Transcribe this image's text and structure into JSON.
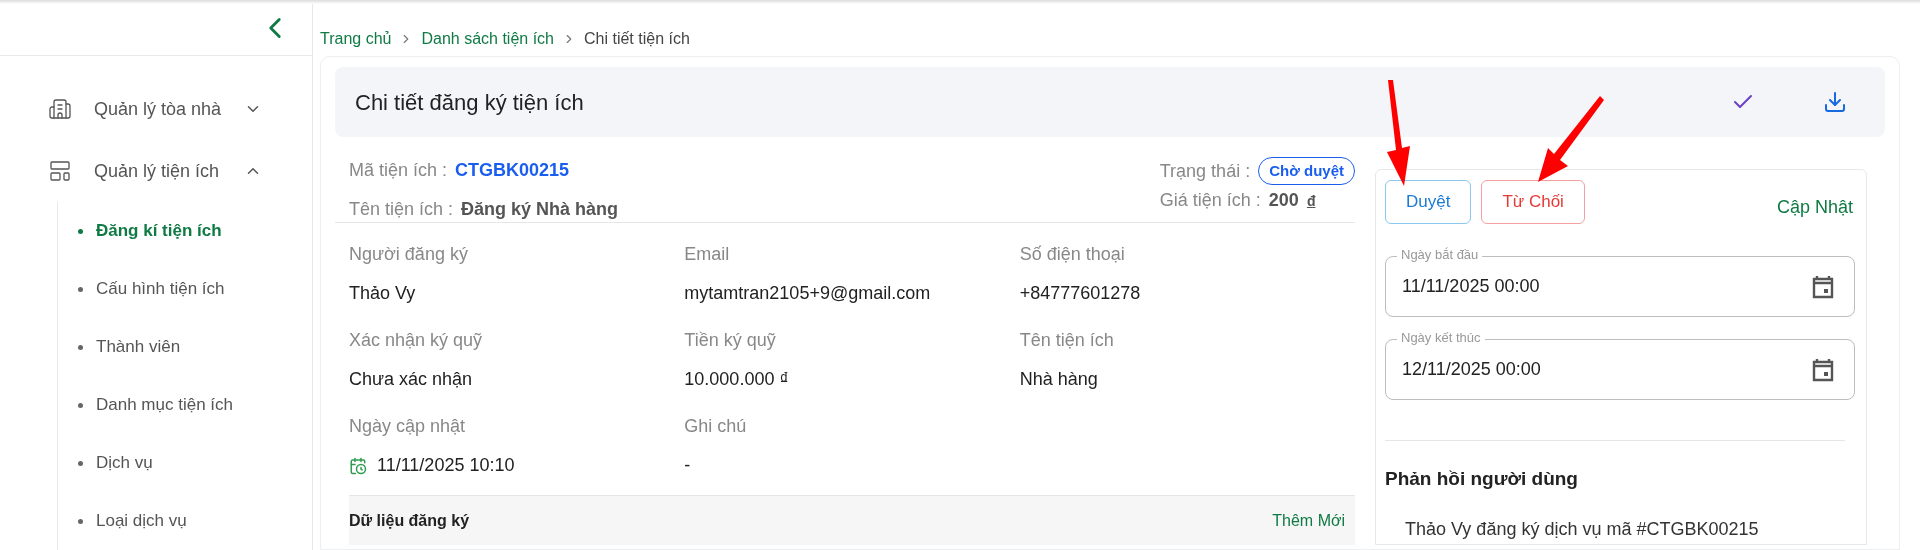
{
  "sidebar": {
    "items": [
      {
        "label": "Quản lý tòa nhà",
        "expanded": false
      },
      {
        "label": "Quản lý tiện ích",
        "expanded": true,
        "children": [
          {
            "label": "Đăng kí tiện ích",
            "selected": true
          },
          {
            "label": "Cấu hình tiện ích",
            "selected": false
          },
          {
            "label": "Thành viên",
            "selected": false
          },
          {
            "label": "Danh mục tiện ích",
            "selected": false
          },
          {
            "label": "Dịch vụ",
            "selected": false
          },
          {
            "label": "Loại dịch vụ",
            "selected": false
          }
        ]
      }
    ]
  },
  "breadcrumb": [
    {
      "label": "Trang chủ",
      "link": true
    },
    {
      "label": "Danh sách tiện ích",
      "link": true
    },
    {
      "label": "Chi tiết tiện ích",
      "link": false
    }
  ],
  "header": {
    "title": "Chi tiết đăng ký tiện ích"
  },
  "summary": {
    "code_label": "Mã tiện ích :",
    "code": "CTGBK00215",
    "name_label": "Tên tiện ích :",
    "name": "Đăng ký Nhà hàng",
    "status_label": "Trạng thái :",
    "status": "Chờ duyệt",
    "price_label": "Giá tiện ích :",
    "price": "200",
    "currency": "đ"
  },
  "fields": [
    {
      "label": "Người đăng ký",
      "value": "Thảo Vy"
    },
    {
      "label": "Email",
      "value": "mytamtran2105+9@gmail.com"
    },
    {
      "label": "Số điện thoại",
      "value": "+84777601278"
    },
    {
      "label": "Xác nhận ký quỹ",
      "value": "Chưa xác nhận"
    },
    {
      "label": "Tiền ký quỹ",
      "value": "10.000.000 ₫"
    },
    {
      "label": "Tên tiện ích",
      "value": "Nhà hàng"
    },
    {
      "label": "Ngày cập nhật",
      "value": "11/11/2025 10:10",
      "kind": "date"
    },
    {
      "label": "Ghi chú",
      "value": "-"
    }
  ],
  "registration_data": {
    "title": "Dữ liệu đăng ký",
    "add": "Thêm Mới"
  },
  "actions": {
    "approve": "Duyệt",
    "reject": "Từ Chối",
    "update": "Cập Nhật"
  },
  "dates": [
    {
      "label": "Ngày bắt đầu",
      "value": "11/11/2025 00:00"
    },
    {
      "label": "Ngày kết thúc",
      "value": "12/11/2025 00:00"
    }
  ],
  "feedback": {
    "title": "Phản hồi người dùng",
    "text": "Thảo Vy đăng ký dịch vụ mã #CTGBK00215"
  }
}
